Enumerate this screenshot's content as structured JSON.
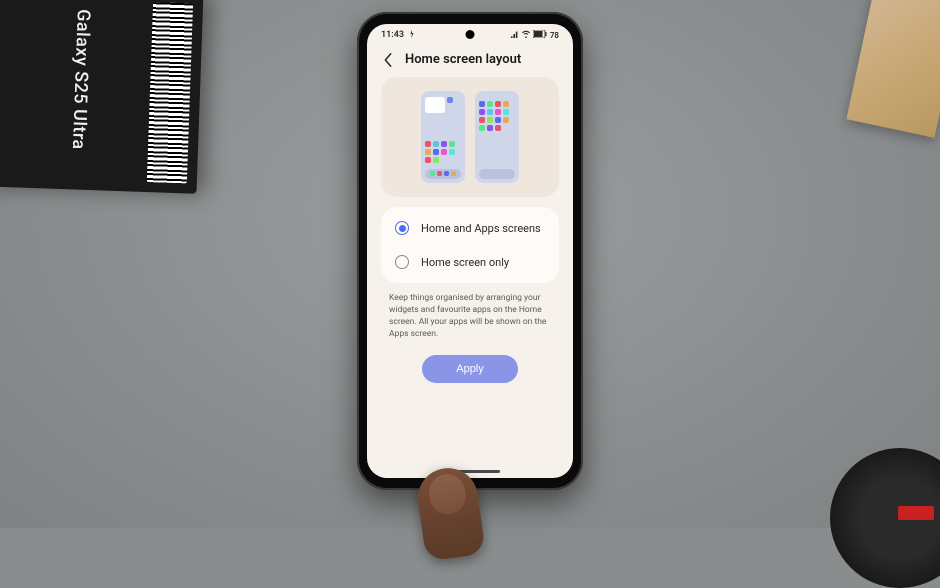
{
  "box_label": "Galaxy S25 Ultra",
  "statusbar": {
    "time": "11:43",
    "battery": "78"
  },
  "header": {
    "title": "Home screen layout"
  },
  "options": {
    "home_and_apps": "Home and Apps screens",
    "home_only": "Home screen only",
    "selected": "home_and_apps"
  },
  "description": "Keep things organised by arranging your widgets and favourite apps on the Home screen. All your apps will be shown on the Apps screen.",
  "apply_label": "Apply",
  "colors": {
    "accent": "#4a6de8",
    "button": "#8a95e8"
  }
}
